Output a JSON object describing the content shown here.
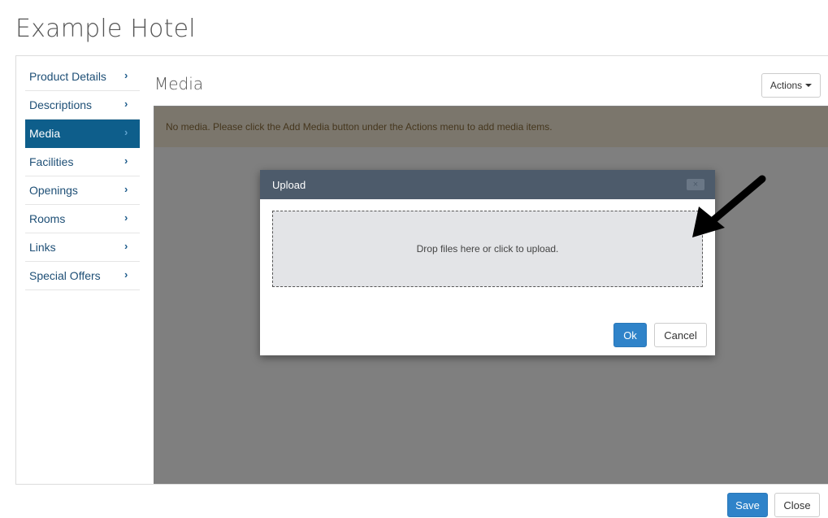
{
  "page": {
    "title": "Example Hotel"
  },
  "sidebar": {
    "items": [
      {
        "label": "Product Details",
        "chevron": "›"
      },
      {
        "label": "Descriptions",
        "chevron": "›"
      },
      {
        "label": "Media",
        "chevron": "›",
        "active": true
      },
      {
        "label": "Facilities",
        "chevron": "›"
      },
      {
        "label": "Openings",
        "chevron": "›"
      },
      {
        "label": "Rooms",
        "chevron": "›"
      },
      {
        "label": "Links",
        "chevron": "›"
      },
      {
        "label": "Special Offers",
        "chevron": "›"
      }
    ]
  },
  "main": {
    "title": "Media",
    "actions_label": "Actions",
    "notice": "No media. Please click the Add Media button under the Actions menu to add media items."
  },
  "modal": {
    "title": "Upload",
    "close_glyph": "×",
    "dropzone_text": "Drop files here or click to upload.",
    "ok_label": "Ok",
    "cancel_label": "Cancel"
  },
  "footer": {
    "save_label": "Save",
    "close_label": "Close"
  },
  "colors": {
    "accent": "#0e5e8b",
    "primary_button": "#2f83c9",
    "modal_header": "#4d5b6b",
    "notice_bg": "#f6ecd9"
  },
  "icons": {
    "chevron": "chevron-right-icon",
    "caret": "caret-down-icon",
    "close": "close-icon",
    "annotation": "arrow-icon"
  }
}
